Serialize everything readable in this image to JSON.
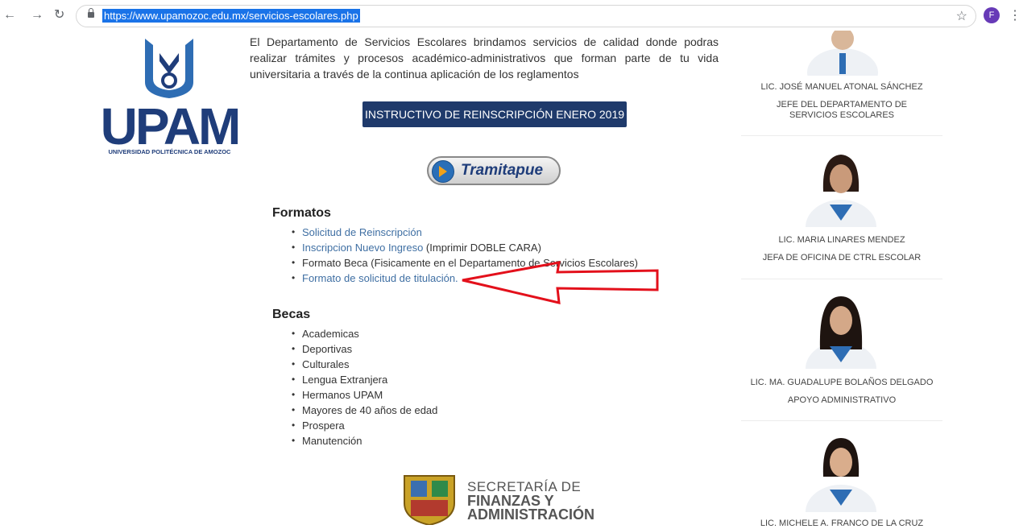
{
  "browser": {
    "url": "https://www.upamozoc.edu.mx/servicios-escolares.php",
    "profile_initial": "F"
  },
  "logo": {
    "word": "UPAM",
    "subtitle": "UNIVERSIDAD POLITÉCNICA DE AMOZOC"
  },
  "main": {
    "intro": "El Departamento de Servicios Escolares brindamos servicios de calidad donde podras realizar trámites y procesos académico-administrativos que forman parte de tu vida universitaria a través de la continua aplicación de los reglamentos",
    "instructivo_button": "INSTRUCTIVO DE REINSCRIPCIÓN ENERO 2019",
    "tramitapue_label": "Tramitapue",
    "formatos": {
      "heading": "Formatos",
      "items": [
        {
          "link": "Solicitud de Reinscripción",
          "text": ""
        },
        {
          "link": "Inscripcion Nuevo Ingreso",
          "text": " (Imprimir DOBLE CARA)"
        },
        {
          "link": "",
          "text": "Formato Beca (Fisicamente en el Departamento de Servicios Escolares)"
        },
        {
          "link": "Formato de solicitud de titulación.",
          "text": ""
        }
      ]
    },
    "becas": {
      "heading": "Becas",
      "items": [
        "Academicas",
        "Deportivas",
        "Culturales",
        "Lengua Extranjera",
        "Hermanos UPAM",
        "Mayores de 40 años de edad",
        "Prospera",
        "Manutención"
      ]
    },
    "secretaria": {
      "line1": "SECRETARÍA DE",
      "line2": "FINANZAS Y",
      "line3": "ADMINISTRACIÓN"
    }
  },
  "staff": [
    {
      "name": "LIC. JOSÉ MANUEL ATONAL SÁNCHEZ",
      "role": "JEFE DEL DEPARTAMENTO DE SERVICIOS ESCOLARES"
    },
    {
      "name": "LIC. MARIA LINARES MENDEZ",
      "role": "JEFA DE OFICINA DE CTRL ESCOLAR"
    },
    {
      "name": "LIC. MA. GUADALUPE BOLAÑOS DELGADO",
      "role": "APOYO ADMINISTRATIVO"
    },
    {
      "name": "LIC. MICHELE A. FRANCO DE LA CRUZ",
      "role": ""
    }
  ],
  "colors": {
    "brand_blue": "#1f3d7a",
    "button_navy": "#1f3a6b",
    "link_blue": "#3f6fa3",
    "arrow_red": "#e3101b"
  }
}
